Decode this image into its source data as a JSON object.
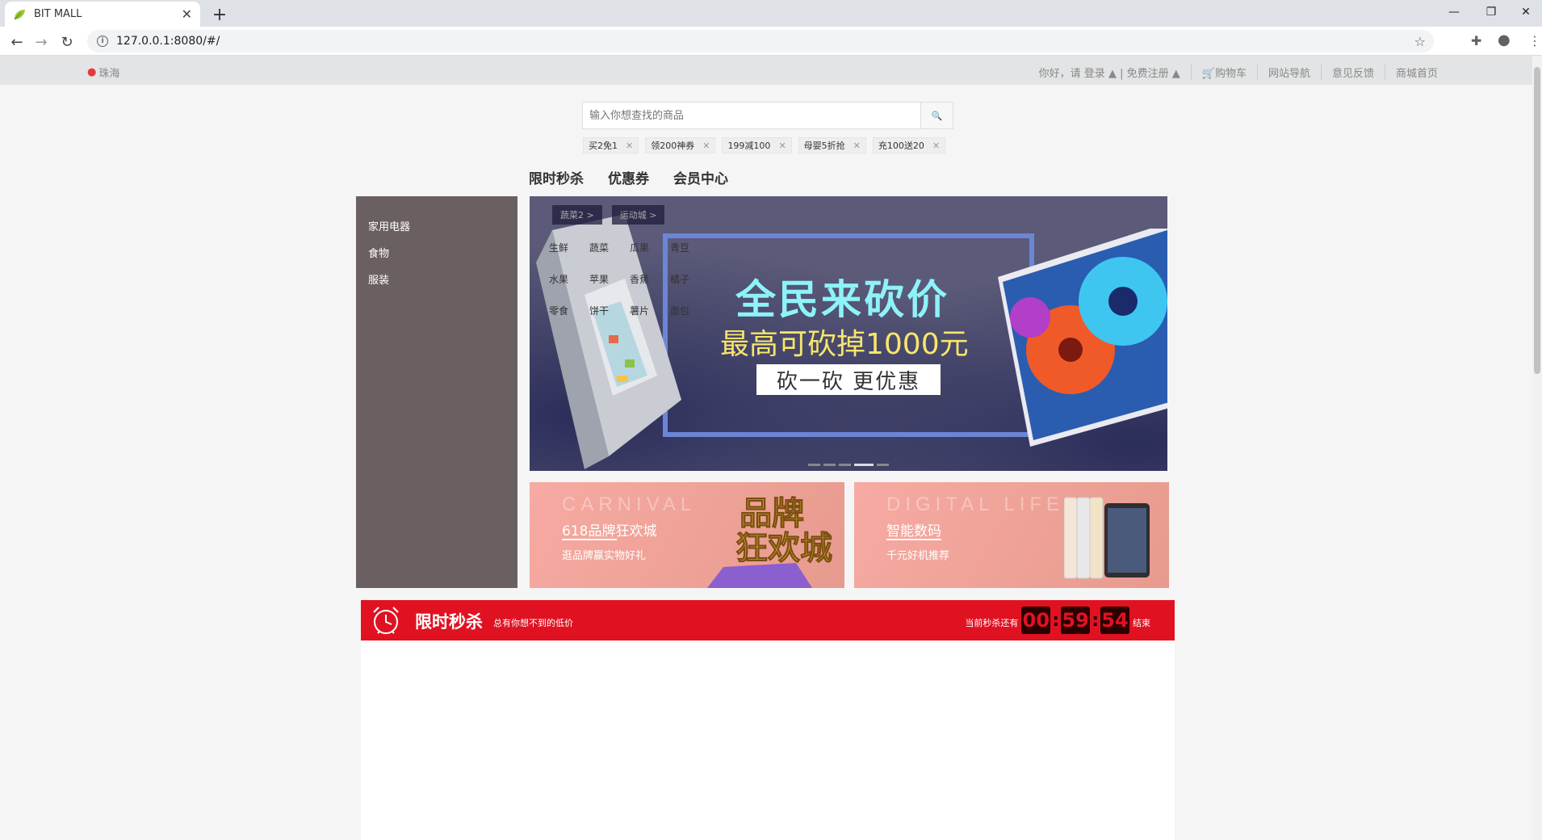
{
  "browser": {
    "tab_title": "BIT MALL",
    "url": "127.0.0.1:8080/#/"
  },
  "sitebar": {
    "location": "珠海",
    "links": [
      "你好，请 登录 ⬇ | 免费注册 ⬇",
      "购物车",
      "网站导航",
      "意见反馈",
      "商城首页"
    ],
    "login_text": "你好，请 登录",
    "register_text": "免费注册",
    "cart": "购物车",
    "site_nav": "网站导航",
    "feedback": "意见反馈",
    "home": "商城首页"
  },
  "search": {
    "placeholder": "输入你想查找的商品",
    "tags": [
      "买2免1",
      "领200神券",
      "199减100",
      "母婴5折抢",
      "充100送20"
    ]
  },
  "mainnav": [
    "限时秒杀",
    "优惠券",
    "会员中心"
  ],
  "categories": [
    "家用电器",
    "食物",
    "服装"
  ],
  "hero": {
    "headline": "全民来砍价",
    "subheadline": "最高可砍掉1000元",
    "cta": "砍一砍 更优惠",
    "subtabs": [
      "蔬菜2 >",
      "运动城 >"
    ],
    "grid": [
      [
        "生鲜",
        "蔬菜",
        "瓜果",
        "青豆"
      ],
      [
        "水果",
        "苹果",
        "香蕉",
        "橘子"
      ],
      [
        "零食",
        "饼干",
        "薯片",
        "面包"
      ]
    ]
  },
  "promos": [
    {
      "bg_text": "CARNIVAL",
      "title": "618品牌狂欢城",
      "subtitle": "逛品牌赢实物好礼",
      "art": "品牌狂欢城"
    },
    {
      "bg_text": "DIGITAL LIFE",
      "title": "智能数码",
      "subtitle": "千元好机推荐"
    }
  ],
  "flash_sale": {
    "title": "限时秒杀",
    "subtitle": "总有你想不到的低价",
    "countdown_prefix": "当前秒杀还有",
    "hours": "00",
    "minutes": "59",
    "seconds": "54",
    "countdown_suffix": "结束"
  },
  "colors": {
    "accent": "#e01222",
    "category_bg": "#6b6061",
    "hero_bg": "#5b5a78"
  }
}
